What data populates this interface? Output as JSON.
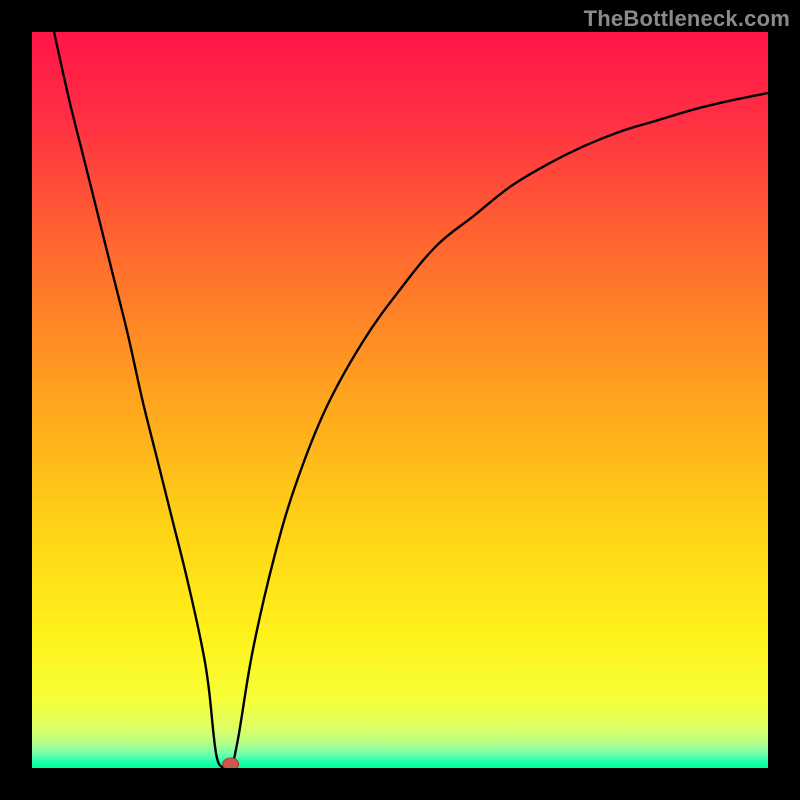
{
  "watermark": "TheBottleneck.com",
  "colors": {
    "frame": "#000000",
    "curve": "#000000",
    "marker_fill": "#c6594d",
    "marker_stroke": "#a84036",
    "gradient_stops": [
      {
        "offset": 0.0,
        "color": "#ff1549"
      },
      {
        "offset": 0.12,
        "color": "#ff3043"
      },
      {
        "offset": 0.3,
        "color": "#ff6a2e"
      },
      {
        "offset": 0.5,
        "color": "#ffa51e"
      },
      {
        "offset": 0.68,
        "color": "#ffd417"
      },
      {
        "offset": 0.82,
        "color": "#fff21a"
      },
      {
        "offset": 0.905,
        "color": "#f6ff36"
      },
      {
        "offset": 0.945,
        "color": "#deff64"
      },
      {
        "offset": 0.965,
        "color": "#b8ff86"
      },
      {
        "offset": 0.982,
        "color": "#6affb0"
      },
      {
        "offset": 0.992,
        "color": "#1dffaf"
      },
      {
        "offset": 1.0,
        "color": "#00ff93"
      }
    ]
  },
  "chart_data": {
    "type": "line",
    "title": "",
    "xlabel": "",
    "ylabel": "",
    "xlim": [
      0,
      100
    ],
    "ylim": [
      0,
      100
    ],
    "x_min_at": 25,
    "marker": {
      "x": 27,
      "y": 0
    },
    "series": [
      {
        "name": "curve",
        "x": [
          3,
          5,
          7,
          9,
          11,
          13,
          15,
          17,
          19,
          21,
          23,
          24,
          25,
          26,
          27,
          28,
          30,
          33,
          36,
          40,
          45,
          50,
          55,
          60,
          65,
          70,
          75,
          80,
          85,
          90,
          95,
          100
        ],
        "y": [
          100,
          91,
          83,
          75,
          67,
          59,
          50,
          42,
          34,
          26,
          17,
          11,
          2,
          0,
          0,
          4,
          16,
          29,
          39,
          49,
          58,
          65,
          71,
          75,
          79,
          82,
          84.5,
          86.5,
          88,
          89.5,
          90.7,
          91.7
        ]
      }
    ]
  }
}
